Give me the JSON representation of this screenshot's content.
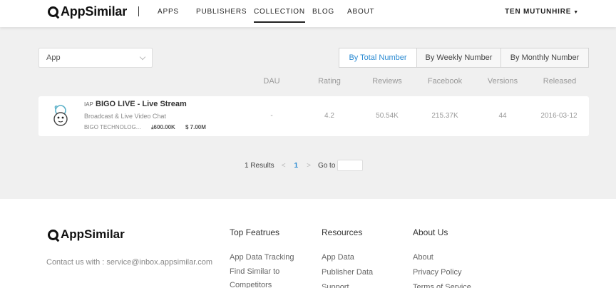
{
  "header": {
    "logo": "AppSimilar",
    "nav": [
      "APPS",
      "PUBLISHERS",
      "COLLECTION",
      "BLOG",
      "ABOUT"
    ],
    "active_nav": "COLLECTION",
    "user": "TEN MUTUNHIRE"
  },
  "filter": {
    "select_value": "App",
    "segments": [
      "By Total Number",
      "By Weekly Number",
      "By Monthly Number"
    ],
    "active_segment": "By Total Number"
  },
  "columns": [
    "DAU",
    "Rating",
    "Reviews",
    "Facebook",
    "Versions",
    "Released"
  ],
  "rows": [
    {
      "tag": "IAP",
      "name": "BIGO LIVE - Live Stream",
      "subtitle": "Broadcast & Live Video Chat",
      "developer": "BIGO TECHNOLOG...",
      "downloads": "600.00K",
      "revenue": "7.00M",
      "dau": "-",
      "rating": "4.2",
      "reviews": "50.54K",
      "facebook": "215.37K",
      "versions": "44",
      "released": "2016-03-12"
    }
  ],
  "pagination": {
    "results": "1 Results",
    "prev": "<",
    "current": "1",
    "next": ">",
    "goto_label": "Go to"
  },
  "footer": {
    "logo": "AppSimilar",
    "contact": "Contact us with : service@inbox.appsimilar.com",
    "columns": [
      {
        "title": "Top Featrues",
        "links": [
          "App Data Tracking",
          "Find Similar to Competitors"
        ]
      },
      {
        "title": "Resources",
        "links": [
          "App Data",
          "Publisher Data",
          "Support"
        ]
      },
      {
        "title": "About Us",
        "links": [
          "About",
          "Privacy Policy",
          "Terms of Service"
        ]
      }
    ]
  },
  "colors": {
    "accent": "#2a8ad2",
    "page_bg": "#f0f0f0"
  }
}
